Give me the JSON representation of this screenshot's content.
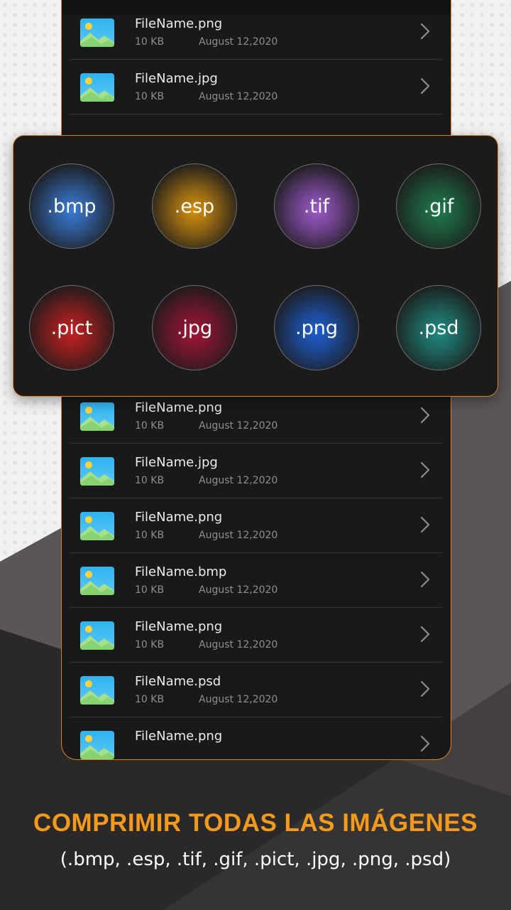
{
  "file_list": {
    "rows_top": [
      {
        "name": "FileName.png",
        "size": "10 KB",
        "date": "August 12,2020"
      },
      {
        "name": "FileName.jpg",
        "size": "10 KB",
        "date": "August 12,2020"
      }
    ],
    "rows_bottom": [
      {
        "name": "FileName.png",
        "size": "10 KB",
        "date": "August 12,2020"
      },
      {
        "name": "FileName.jpg",
        "size": "10 KB",
        "date": "August 12,2020"
      },
      {
        "name": "FileName.png",
        "size": "10 KB",
        "date": "August 12,2020"
      },
      {
        "name": "FileName.bmp",
        "size": "10 KB",
        "date": "August 12,2020"
      },
      {
        "name": "FileName.png",
        "size": "10 KB",
        "date": "August 12,2020"
      },
      {
        "name": "FileName.psd",
        "size": "10 KB",
        "date": "August 12,2020"
      },
      {
        "name": "FileName.png",
        "size": "",
        "date": ""
      }
    ],
    "row_icon": "image-file-icon",
    "row_action_icon": "chevron-right-icon"
  },
  "formats": [
    {
      "label": ".bmp",
      "color": "#3a7bd5"
    },
    {
      "label": ".esp",
      "color": "#d4900f"
    },
    {
      "label": ".tif",
      "color": "#9b59c8"
    },
    {
      "label": ".gif",
      "color": "#1f7a4a"
    },
    {
      "label": ".pict",
      "color": "#c42020"
    },
    {
      "label": ".jpg",
      "color": "#a01535"
    },
    {
      "label": ".png",
      "color": "#1e5fd0"
    },
    {
      "label": ".psd",
      "color": "#1f8a80"
    }
  ],
  "promo": {
    "headline": "COMPRIMIR TODAS LAS IMÁGENES",
    "subline": "(.bmp, .esp, .tif, .gif, .pict, .jpg, .png, .psd)"
  },
  "colors": {
    "accent": "#f39a1c",
    "panel_border": "#d9821a",
    "panel_bg": "#1b1b1b"
  }
}
